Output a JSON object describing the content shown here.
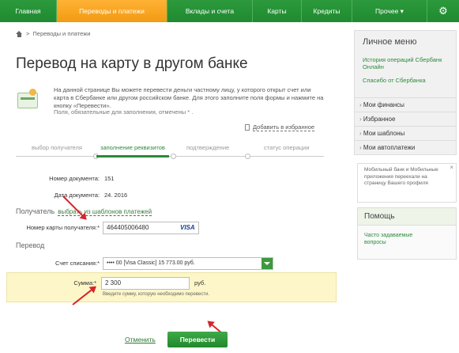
{
  "nav": {
    "items": [
      {
        "label": "Главная",
        "active": false
      },
      {
        "label": "Переводы и платежи",
        "active": true
      },
      {
        "label": "Вклады и счета",
        "active": false
      },
      {
        "label": "Карты",
        "active": false
      },
      {
        "label": "Кредиты",
        "active": false
      },
      {
        "label": "Прочее ▾",
        "active": false
      }
    ],
    "settings_icon": "gear-icon",
    "settings_glyph": "⚙"
  },
  "breadcrumb": {
    "link": "Переводы и платежи",
    "separator": ">"
  },
  "title": "Перевод на карту в другом банке",
  "info": {
    "text": "На данной странице Вы можете перевести деньги частному лицу, у которого открыт счет или карта в Сбербанке или другом российском банке. Для этого заполните поля формы и нажмите на кнопку «Перевести».",
    "required_note": "Поля, обязательные для заполнения, отмечены * ."
  },
  "favorites": "Добавить в избранное",
  "steps": [
    "выбор получателя",
    "заполнение реквизитов",
    "подтверждение",
    "статус операции"
  ],
  "active_step": 1,
  "form": {
    "doc_number_label": "Номер документа:",
    "doc_number_value": "151",
    "doc_date_label": "Дата документа:",
    "doc_date_value": "24.   2016",
    "recipient_section": "Получатель",
    "recipient_template_link": "выбрать из шаблонов платежей",
    "card_label": "Номер карты получателя:*",
    "card_value": "464405006480",
    "card_brand": "VISA",
    "transfer_section": "Перевод",
    "account_label": "Счет списания:*",
    "account_value": "••••   00  [Visa Classic] 15 773.00  руб.",
    "amount_label": "Сумма:*",
    "amount_value": "2 300",
    "amount_currency": "руб.",
    "amount_hint": "Введите сумму, которую необходимо перевести."
  },
  "actions": {
    "cancel": "Отменить",
    "submit": "Перевести"
  },
  "sidebar": {
    "title": "Личное меню",
    "links": [
      "История операций Сбербанк Онлайн",
      "Спасибо от Сбербанка"
    ],
    "items": [
      "Мои финансы",
      "Избранное",
      "Мои шаблоны",
      "Мои автоплатежи"
    ],
    "promo": "Мобильный банк и Мобильные приложения переехали на страницу Вашего профиля",
    "promo_close": "×",
    "help_title": "Помощь",
    "help_link": "Часто задаваемые вопросы"
  },
  "colors": {
    "accent_green": "#2c9a3c",
    "active_orange": "#f29a12",
    "annotation_red": "#d8232a",
    "highlight_yellow": "#fdf6c8"
  }
}
